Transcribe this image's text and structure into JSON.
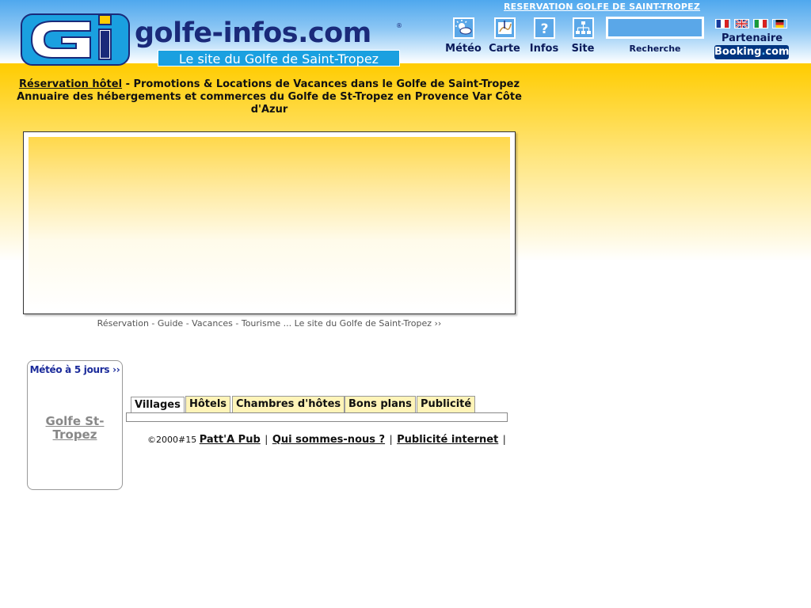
{
  "header": {
    "top_link": "RESERVATION GOLFE DE SAINT-TROPEZ",
    "logo_letters": "Gi",
    "logo_name": "golfe-infos.com",
    "logo_registered": "®",
    "logo_tagline": "Le site du Golfe de Saint-Tropez",
    "nav": [
      {
        "label": "Météo",
        "icon": "weather-icon"
      },
      {
        "label": "Carte",
        "icon": "map-icon"
      },
      {
        "label": "Infos",
        "icon": "question-icon"
      },
      {
        "label": "Site",
        "icon": "sitemap-icon"
      }
    ],
    "search": {
      "value": "",
      "label": "Recherche"
    },
    "flags": [
      "fr-flag-icon",
      "uk-flag-icon",
      "it-flag-icon",
      "de-flag-icon"
    ],
    "partner_label": "Partenaire",
    "booking": {
      "name": "Booking",
      "dot": ".",
      "tld": "com"
    }
  },
  "intro": {
    "link_text": "Réservation hôtel",
    "line1_rest": " - Promotions & Locations de Vacances dans le Golfe de Saint-Tropez",
    "line2": "Annuaire des hébergements et commerces du Golfe de St-Tropez en Provence Var Côte d'Azur"
  },
  "banner": {
    "caption": "Réservation - Guide - Vacances - Tourisme ... Le site du Golfe de Saint-Tropez ››"
  },
  "meteo": {
    "title": "Météo à 5 jours ››",
    "link": "Golfe St-Tropez"
  },
  "tabs": [
    {
      "label": "Villages",
      "active": true
    },
    {
      "label": "Hôtels",
      "active": false
    },
    {
      "label": "Chambres d'hôtes",
      "active": false
    },
    {
      "label": "Bons plans",
      "active": false
    },
    {
      "label": "Publicité",
      "active": false
    }
  ],
  "footer": {
    "copyright": "©2000#15",
    "links": [
      "Patt'A Pub",
      "Qui sommes-nous ?",
      "Publicité internet"
    ],
    "separator": "|"
  },
  "colors": {
    "header_blue": "#4fa8ee",
    "brand_navy": "#1a2a7a",
    "accent_yellow": "#ffcc00",
    "tab_yellow": "#fff4b8",
    "booking_blue": "#003580"
  }
}
